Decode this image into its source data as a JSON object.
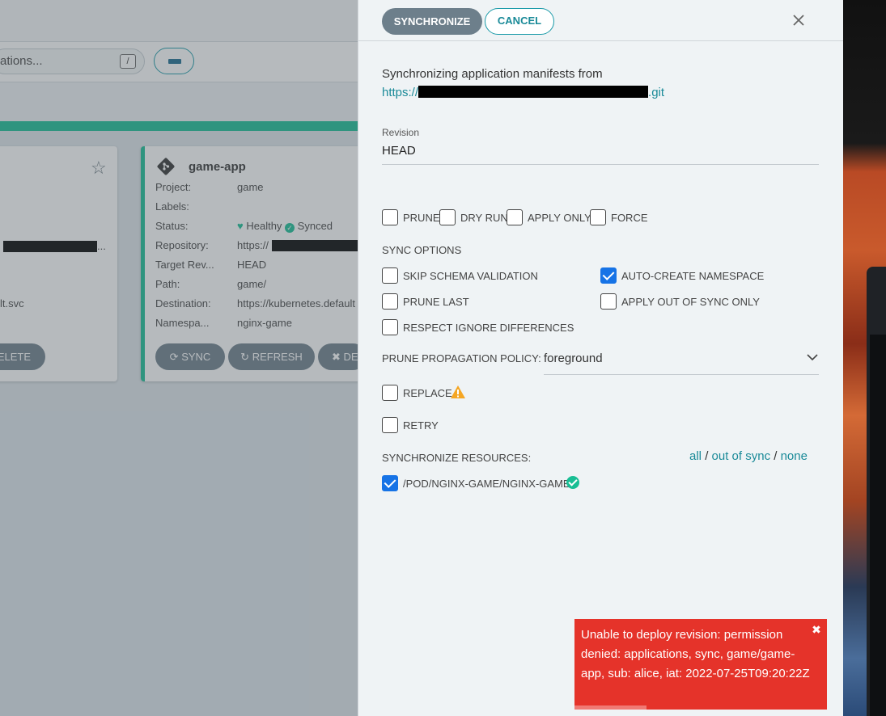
{
  "background_app": {
    "search": {
      "text_visible": "ations...",
      "shortcut": "/"
    },
    "card_left": {
      "repo_suffix": "...",
      "destination_suffix": "lt.svc",
      "delete_label_fragment": "ELETE"
    },
    "card_game": {
      "title": "game-app",
      "rows": [
        {
          "label": "Project:",
          "value": "game"
        },
        {
          "label": "Labels:",
          "value": ""
        },
        {
          "label": "Status:",
          "health": "Healthy",
          "sync": "Synced"
        },
        {
          "label": "Repository:",
          "value": "https://"
        },
        {
          "label": "Target Rev...",
          "value": "HEAD"
        },
        {
          "label": "Path:",
          "value": "game/"
        },
        {
          "label": "Destination:",
          "value": "https://kubernetes.default"
        },
        {
          "label": "Namespa...",
          "value": "nginx-game"
        }
      ],
      "buttons": {
        "sync": "SYNC",
        "refresh": "REFRESH",
        "delete_fragment": "DE"
      }
    }
  },
  "sync_panel": {
    "synchronize_label": "SYNCHRONIZE",
    "cancel_label": "CANCEL",
    "intro": "Synchronizing application manifests from",
    "repo_prefix": "https://",
    "repo_suffix": ".git",
    "revision_label": "Revision",
    "revision_value": "HEAD",
    "top_options": [
      {
        "label": "PRUNE",
        "checked": false
      },
      {
        "label": "DRY RUN",
        "checked": false
      },
      {
        "label": "APPLY ONLY",
        "checked": false
      },
      {
        "label": "FORCE",
        "checked": false
      }
    ],
    "sync_options_title": "SYNC OPTIONS",
    "sync_options": [
      {
        "label": "SKIP SCHEMA VALIDATION",
        "checked": false
      },
      {
        "label": "AUTO-CREATE NAMESPACE",
        "checked": true
      },
      {
        "label": "PRUNE LAST",
        "checked": false
      },
      {
        "label": "APPLY OUT OF SYNC ONLY",
        "checked": false
      },
      {
        "label": "RESPECT IGNORE DIFFERENCES",
        "checked": false
      }
    ],
    "prune_policy_label": "PRUNE PROPAGATION POLICY:",
    "prune_policy_value": "foreground",
    "replace_label": "REPLACE",
    "retry_label": "RETRY",
    "resources_title": "SYNCHRONIZE RESOURCES:",
    "resource_links": {
      "all": "all",
      "out_of_sync": "out of sync",
      "none": "none",
      "separator": "/"
    },
    "resources": [
      {
        "label": "/POD/NGINX-GAME/NGINX-GAME",
        "checked": true
      }
    ]
  },
  "toast": {
    "message": "Unable to deploy revision: permission denied: applications, sync, game/game-app, sub: alice, iat: 2022-07-25T09:20:22Z",
    "close_glyph": "✖"
  },
  "colors": {
    "accent": "#1a8a98",
    "primary_button": "#6d7f8b",
    "healthy": "#18be94",
    "error": "#e5332a",
    "checkbox": "#1673e6"
  }
}
